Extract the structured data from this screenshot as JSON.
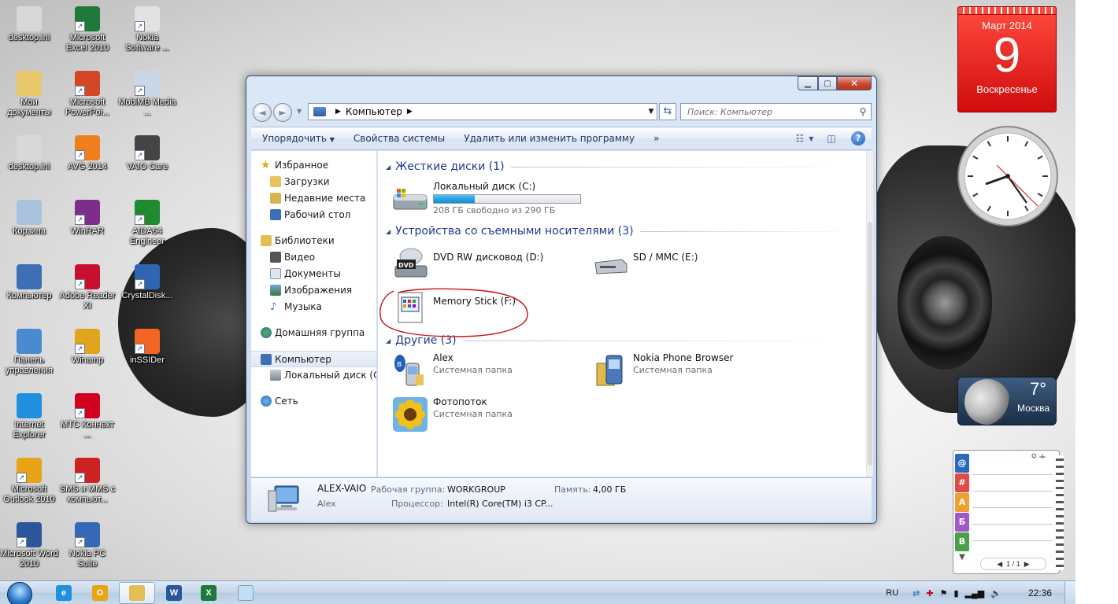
{
  "desktop": {
    "icons": [
      {
        "label": "desktop.ini",
        "icon": "ini-file-icon",
        "color": "#d8d8d8"
      },
      {
        "label": "Microsoft Excel 2010",
        "icon": "excel-icon",
        "color": "#1f7a3a"
      },
      {
        "label": "Nokia Software ...",
        "icon": "nokia-software-icon",
        "color": "#e2e2e2"
      },
      {
        "label": "Мои документы",
        "icon": "folder-icon",
        "color": "#e9c86a"
      },
      {
        "label": "Microsoft PowerPoi...",
        "icon": "powerpoint-icon",
        "color": "#d24726"
      },
      {
        "label": "MobiMB Media ...",
        "icon": "mobimb-icon",
        "color": "#c9d7e8"
      },
      {
        "label": "desktop.ini",
        "icon": "ini-file-icon",
        "color": "#d8d8d8"
      },
      {
        "label": "AVG 2014",
        "icon": "avg-icon",
        "color": "#f07f1b"
      },
      {
        "label": "VAIO Care",
        "icon": "vaio-care-icon",
        "color": "#444444"
      },
      {
        "label": "Корзина",
        "icon": "recycle-bin-icon",
        "color": "#a9c2de"
      },
      {
        "label": "WinRAR",
        "icon": "winrar-icon",
        "color": "#7d2d8a"
      },
      {
        "label": "AIDA64 Engineer",
        "icon": "aida64-icon",
        "color": "#1f8a2e"
      },
      {
        "label": "Компьютер",
        "icon": "computer-icon",
        "color": "#3d6fb5"
      },
      {
        "label": "Adobe Reader XI",
        "icon": "adobe-reader-icon",
        "color": "#c8102e"
      },
      {
        "label": "CrystalDisk...",
        "icon": "crystaldisk-icon",
        "color": "#2f66b3"
      },
      {
        "label": "Панель управления",
        "icon": "control-panel-icon",
        "color": "#4a8ad0"
      },
      {
        "label": "Winamp",
        "icon": "winamp-icon",
        "color": "#e0a41d"
      },
      {
        "label": "inSSIDer",
        "icon": "inssider-icon",
        "color": "#f26522"
      },
      {
        "label": "Internet Explorer",
        "icon": "internet-explorer-icon",
        "color": "#1f8fe0"
      },
      {
        "label": "МТС Коннект ...",
        "icon": "mts-connect-icon",
        "color": "#d2001f"
      },
      {
        "label": "",
        "icon": "empty",
        "color": "transparent"
      },
      {
        "label": "Microsoft Outlook 2010",
        "icon": "outlook-icon",
        "color": "#e8a317"
      },
      {
        "label": "SMS и MMS с компьют...",
        "icon": "sms-mms-icon",
        "color": "#cc2222"
      },
      {
        "label": "",
        "icon": "empty",
        "color": "transparent"
      },
      {
        "label": "Microsoft Word 2010",
        "icon": "word-icon",
        "color": "#2b579a"
      },
      {
        "label": "Nokia PC Suite",
        "icon": "nokia-pc-suite-icon",
        "color": "#3568b6"
      }
    ]
  },
  "explorer": {
    "address": {
      "crumb": "Компьютер"
    },
    "search": {
      "placeholder": "Поиск: Компьютер"
    },
    "toolbar": {
      "organize": "Упорядочить",
      "system_properties": "Свойства системы",
      "uninstall": "Удалить или изменить программу",
      "more": "»"
    },
    "nav": {
      "favorites": "Избранное",
      "downloads": "Загрузки",
      "recent": "Недавние места",
      "desktop": "Рабочий стол",
      "libraries": "Библиотеки",
      "video": "Видео",
      "documents": "Документы",
      "images": "Изображения",
      "music": "Музыка",
      "homegroup": "Домашняя группа",
      "computer": "Компьютер",
      "local_disk": "Локальный диск (C",
      "network": "Сеть"
    },
    "groups": {
      "hard_disks": "Жесткие диски (1)",
      "removable": "Устройства со съемными носителями (3)",
      "other": "Другие (3)"
    },
    "items": {
      "local_disk": {
        "name": "Локальный диск (C:)",
        "free": "208 ГБ свободно из 290 ГБ",
        "used_fraction": 0.28
      },
      "dvd": {
        "name": "DVD RW дисковод (D:)"
      },
      "sd": {
        "name": "SD / MMC (E:)"
      },
      "memory_stick": {
        "name": "Memory Stick (F:)"
      },
      "alex": {
        "name": "Alex",
        "type": "Системная папка"
      },
      "nokia_browser": {
        "name": "Nokia Phone Browser",
        "type": "Системная папка"
      },
      "photostream": {
        "name": "Фотопоток",
        "type": "Системная папка"
      }
    },
    "details": {
      "computer_name": "ALEX-VAIO",
      "workgroup_label": "Рабочая группа:",
      "workgroup": "WORKGROUP",
      "memory_label": "Память:",
      "memory": "4,00 ГБ",
      "user": "Alex",
      "cpu_label": "Процессор:",
      "cpu": "Intel(R) Core(TM) i3 CP..."
    }
  },
  "gadgets": {
    "calendar": {
      "month": "Март 2014",
      "day": "9",
      "weekday": "Воскресенье"
    },
    "weather": {
      "temp": "7°",
      "city": "Москва"
    },
    "notes": {
      "tabs": [
        "@",
        "#",
        "А",
        "Б",
        "В"
      ],
      "pager": "1 / 1"
    }
  },
  "taskbar": {
    "lang": "RU",
    "time": "22:36"
  },
  "colors": {
    "accent": "#1e3a8c",
    "progress": "#25a3e6",
    "annotation": "#cc1111"
  }
}
